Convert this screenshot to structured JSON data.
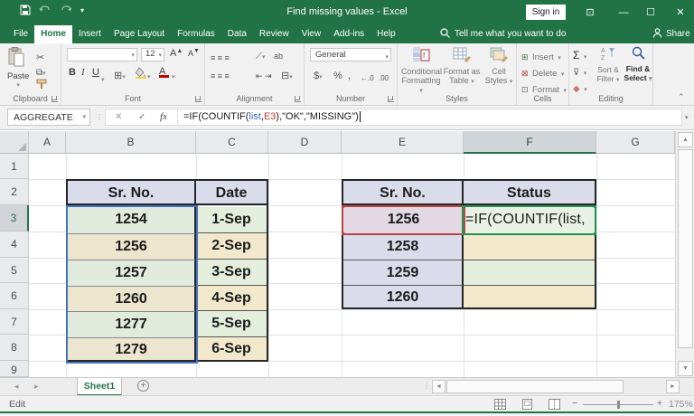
{
  "window": {
    "title": "Find missing values - Excel",
    "sign_in": "Sign in",
    "brand_color": "#217346"
  },
  "ribbon_tabs": [
    {
      "label": "File"
    },
    {
      "label": "Home"
    },
    {
      "label": "Insert"
    },
    {
      "label": "Page Layout"
    },
    {
      "label": "Formulas"
    },
    {
      "label": "Data"
    },
    {
      "label": "Review"
    },
    {
      "label": "View"
    },
    {
      "label": "Add-ins"
    },
    {
      "label": "Help"
    }
  ],
  "tell_me": "Tell me what you want to do",
  "share_label": "Share",
  "ribbon": {
    "clipboard": {
      "label": "Clipboard",
      "paste": "Paste"
    },
    "font": {
      "label": "Font",
      "size": "12",
      "bold": "B",
      "italic": "I",
      "underline": "U",
      "grow": "A",
      "shrink": "A"
    },
    "alignment": {
      "label": "Alignment"
    },
    "number": {
      "label": "Number",
      "format": "General",
      "currency": "$",
      "percent": "%",
      "comma": ","
    },
    "styles": {
      "label": "Styles",
      "cf1": "Conditional",
      "cf2": "Formatting",
      "fat1": "Format as",
      "fat2": "Table",
      "cs1": "Cell",
      "cs2": "Styles"
    },
    "cells": {
      "label": "Cells",
      "insert": "Insert",
      "delete": "Delete",
      "format": "Format"
    },
    "editing": {
      "label": "Editing",
      "autosum": "Σ",
      "sort1": "Sort &",
      "sort2": "Filter",
      "find1": "Find &",
      "find2": "Select"
    }
  },
  "formula_bar": {
    "name_box": "AGGREGATE",
    "fx": "fx",
    "prefix": "=IF(COUNTIF(",
    "ref1": "list",
    "comma": ",",
    "ref2": "E3",
    "suffix": "),\"OK\",\"MISSING\")"
  },
  "grid": {
    "columns": [
      "A",
      "B",
      "C",
      "D",
      "E",
      "F",
      "G"
    ],
    "rows": [
      "1",
      "2",
      "3",
      "4",
      "5",
      "6",
      "7",
      "8",
      "9"
    ]
  },
  "left_table": {
    "headers": [
      "Sr. No.",
      "Date"
    ],
    "rows": [
      [
        "1254",
        "1-Sep"
      ],
      [
        "1256",
        "2-Sep"
      ],
      [
        "1257",
        "3-Sep"
      ],
      [
        "1260",
        "4-Sep"
      ],
      [
        "1277",
        "5-Sep"
      ],
      [
        "1279",
        "6-Sep"
      ]
    ]
  },
  "right_table": {
    "headers": [
      "Sr. No.",
      "Status"
    ],
    "rows": [
      "1256",
      "1258",
      "1259",
      "1260"
    ],
    "f3_text": "=IF(COUNTIF(list,"
  },
  "sheet_bar": {
    "tab": "Sheet1"
  },
  "status_bar": {
    "mode": "Edit",
    "zoom": "175%"
  },
  "colors": {
    "green_fill": "#e1ebdd",
    "tan_fill": "#ece6cf",
    "lavender": "#dadcec",
    "pink": "#e4d9e2",
    "ref_blue": "#4472c4",
    "ref_red": "#b94743",
    "edit_green": "#279152"
  }
}
